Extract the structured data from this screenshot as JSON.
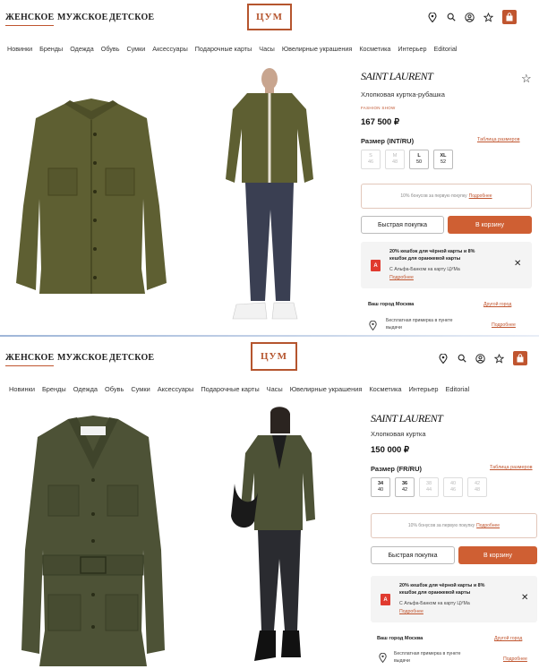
{
  "colors": {
    "accent": "#c0552f",
    "cart_button": "#cf5f33",
    "alfa": "#e03a2f",
    "jacket": "#5e5f32"
  },
  "icons": [
    "location-icon",
    "search-icon",
    "profile-icon",
    "star-icon",
    "bag-icon",
    "close-icon",
    "pin-icon"
  ],
  "screens": [
    {
      "header": {
        "genders": [
          {
            "label": "ЖЕНСКОЕ",
            "active": true
          },
          {
            "label": "МУЖСКОЕ",
            "active": false
          },
          {
            "label": "ДЕТСКОЕ",
            "active": false
          }
        ],
        "logo": "ЦУМ"
      },
      "categories": [
        "Новинки",
        "Бренды",
        "Одежда",
        "Обувь",
        "Сумки",
        "Аксессуары",
        "Подарочные карты",
        "Часы",
        "Ювелирные украшения",
        "Косметика",
        "Интерьер",
        "Editorial"
      ],
      "product": {
        "brand": "SAINT LAURENT",
        "title": "Хлопковая куртка-рубашка",
        "badge": "FASHION SHOW",
        "price": "167 500 ₽",
        "size_label": "Размер (INT/RU)",
        "size_table": "Таблица размеров",
        "sizes": [
          {
            "top": "S",
            "bottom": "46",
            "available": false
          },
          {
            "top": "M",
            "bottom": "48",
            "available": false
          },
          {
            "top": "L",
            "bottom": "50",
            "available": true
          },
          {
            "top": "XL",
            "bottom": "52",
            "available": true
          }
        ],
        "bonus_text": "10% бонусов за первую покупку",
        "bonus_link": "Подробнее",
        "quick_buy": "Быстрая покупка",
        "add_to_cart": "В корзину",
        "promo": {
          "line1": "20% кешбэк для чёрной карты и 8%",
          "line2": "кешбэк для оранжевой карты",
          "line3": "С Альфа-Банком на карту ЦУМа",
          "link": "Подробнее",
          "logo_letter": "А"
        },
        "city_label": "Ваш город Москва",
        "city_other": "Другой город",
        "fitting_1": "Бесплатная примерка в пункте",
        "fitting_2": "выдачи",
        "fitting_more": "Подробнее"
      }
    },
    {
      "header": {
        "genders": [
          {
            "label": "ЖЕНСКОЕ",
            "active": true
          },
          {
            "label": "МУЖСКОЕ",
            "active": false
          },
          {
            "label": "ДЕТСКОЕ",
            "active": false
          }
        ],
        "logo": "ЦУМ"
      },
      "categories": [
        "Новинки",
        "Бренды",
        "Одежда",
        "Обувь",
        "Сумки",
        "Аксессуары",
        "Подарочные карты",
        "Часы",
        "Ювелирные украшения",
        "Косметика",
        "Интерьер",
        "Editorial"
      ],
      "product": {
        "brand": "SAINT LAURENT",
        "title": "Хлопковая куртка",
        "price": "150 000 ₽",
        "size_label": "Размер (FR/RU)",
        "size_table": "Таблица размеров",
        "sizes": [
          {
            "top": "34",
            "bottom": "40",
            "available": true
          },
          {
            "top": "36",
            "bottom": "42",
            "available": true
          },
          {
            "top": "38",
            "bottom": "44",
            "available": false
          },
          {
            "top": "40",
            "bottom": "46",
            "available": false
          },
          {
            "top": "42",
            "bottom": "48",
            "available": false
          }
        ],
        "bonus_text": "10% бонусов за первую покупку",
        "bonus_link": "Подробнее",
        "quick_buy": "Быстрая покупка",
        "add_to_cart": "В корзину",
        "promo": {
          "line1": "20% кешбэк для чёрной карты и 8%",
          "line2": "кешбэк для оранжевой карты",
          "line3": "С Альфа-Банком на карту ЦУМа",
          "link": "Подробнее",
          "logo_letter": "А"
        },
        "city_label": "Ваш город Москва",
        "city_other": "Другой город",
        "fitting_1": "Бесплатная примерка в пункте",
        "fitting_2": "выдачи",
        "fitting_more": "Подробнее"
      }
    }
  ]
}
